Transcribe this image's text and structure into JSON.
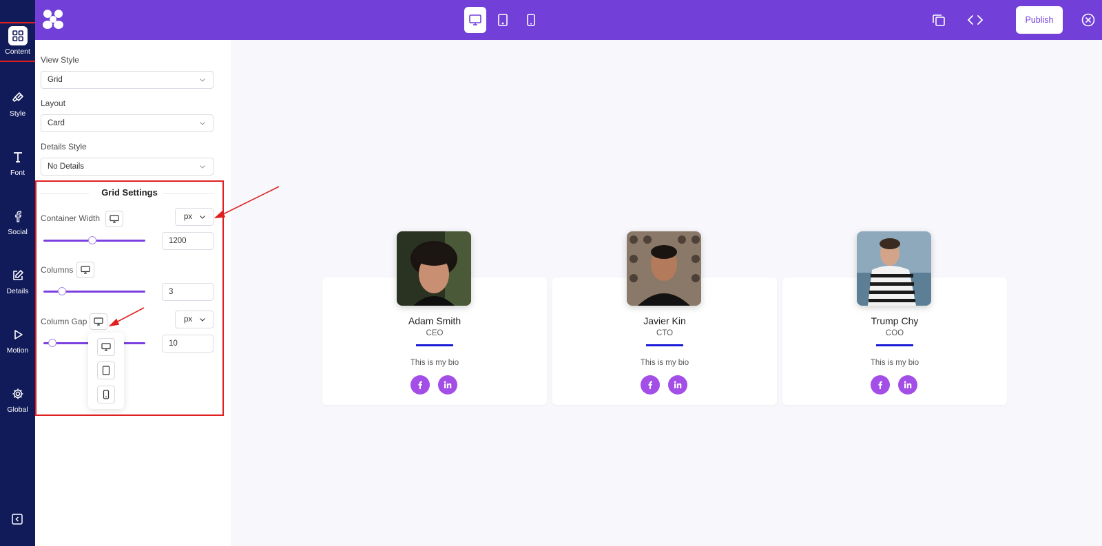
{
  "nav": {
    "items": [
      {
        "label": "Content",
        "icon": "grid-icon"
      },
      {
        "label": "Style",
        "icon": "brush-icon"
      },
      {
        "label": "Font",
        "icon": "text-icon"
      },
      {
        "label": "Social",
        "icon": "facebook-icon"
      },
      {
        "label": "Details",
        "icon": "edit-icon"
      },
      {
        "label": "Motion",
        "icon": "play-icon"
      },
      {
        "label": "Global",
        "icon": "gear-icon"
      }
    ]
  },
  "topbar": {
    "publish_label": "Publish"
  },
  "settings": {
    "view_style": {
      "label": "View Style",
      "value": "Grid"
    },
    "layout": {
      "label": "Layout",
      "value": "Card"
    },
    "details_style": {
      "label": "Details Style",
      "value": "No Details"
    },
    "grid": {
      "title": "Grid Settings",
      "container_width": {
        "label": "Container Width",
        "unit": "px",
        "value": "1200",
        "slider_fraction": 0.48
      },
      "columns": {
        "label": "Columns",
        "value": "3",
        "slider_fraction": 0.18
      },
      "column_gap": {
        "label": "Column Gap",
        "unit": "px",
        "value": "10",
        "slider_fraction": 0.09
      }
    }
  },
  "team": [
    {
      "name": "Adam Smith",
      "role": "CEO",
      "bio": "This is my bio"
    },
    {
      "name": "Javier Kin",
      "role": "CTO",
      "bio": "This is my bio"
    },
    {
      "name": "Trump Chy",
      "role": "COO",
      "bio": "This is my bio"
    }
  ],
  "colors": {
    "nav_bg": "#111b5a",
    "topbar_bg": "#7240d8",
    "accent": "#7c3fe0",
    "divider": "#1a1ad8",
    "social": "#a34ee6",
    "highlight": "#e02020"
  }
}
